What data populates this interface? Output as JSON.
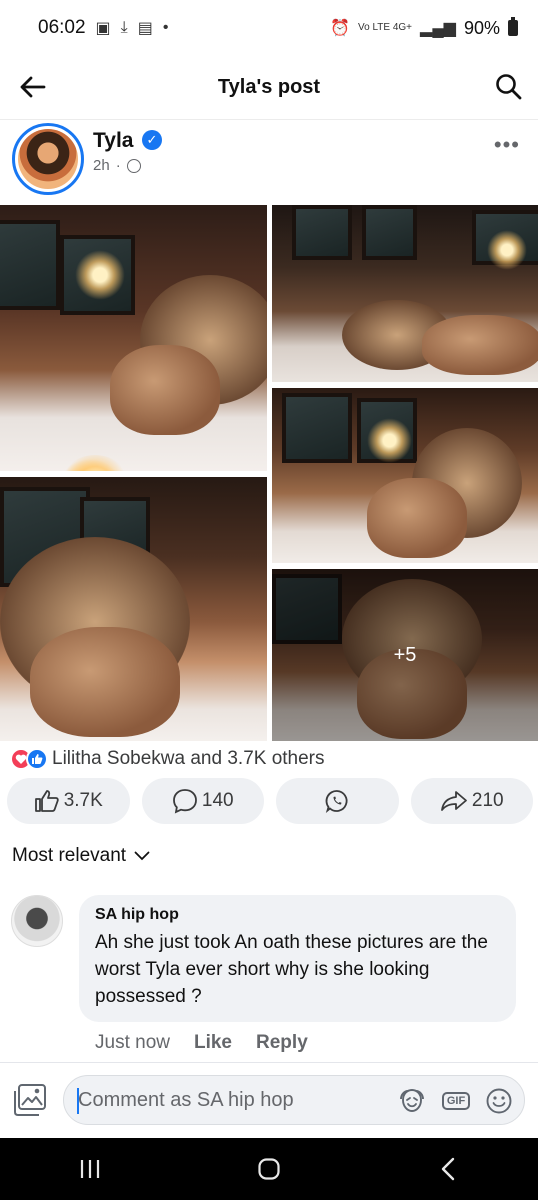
{
  "status_bar": {
    "time": "06:02",
    "signal_text": "Vo LTE 4G+",
    "battery": "90%"
  },
  "header": {
    "title": "Tyla's post"
  },
  "post": {
    "author": "Tyla",
    "verified": true,
    "time": "2h",
    "privacy_icon": "globe-icon",
    "more_photos": "+5"
  },
  "reactions": {
    "summary": "Lilitha Sobekwa and 3.7K others",
    "types": [
      "love",
      "like"
    ]
  },
  "actions": {
    "like_count": "3.7K",
    "comment_count": "140",
    "share_count": "210"
  },
  "sort": {
    "label": "Most relevant"
  },
  "comment": {
    "author": "SA hip hop",
    "text": "Ah she just took An oath these pictures are the worst Tyla ever short why is she looking possessed ?",
    "time": "Just now",
    "like_label": "Like",
    "reply_label": "Reply"
  },
  "composer": {
    "placeholder": "Comment as SA hip hop"
  },
  "colors": {
    "accent": "#1877f2",
    "love": "#f33e58",
    "pill_bg": "#eef0f3",
    "bubble_bg": "#f0f2f5"
  }
}
